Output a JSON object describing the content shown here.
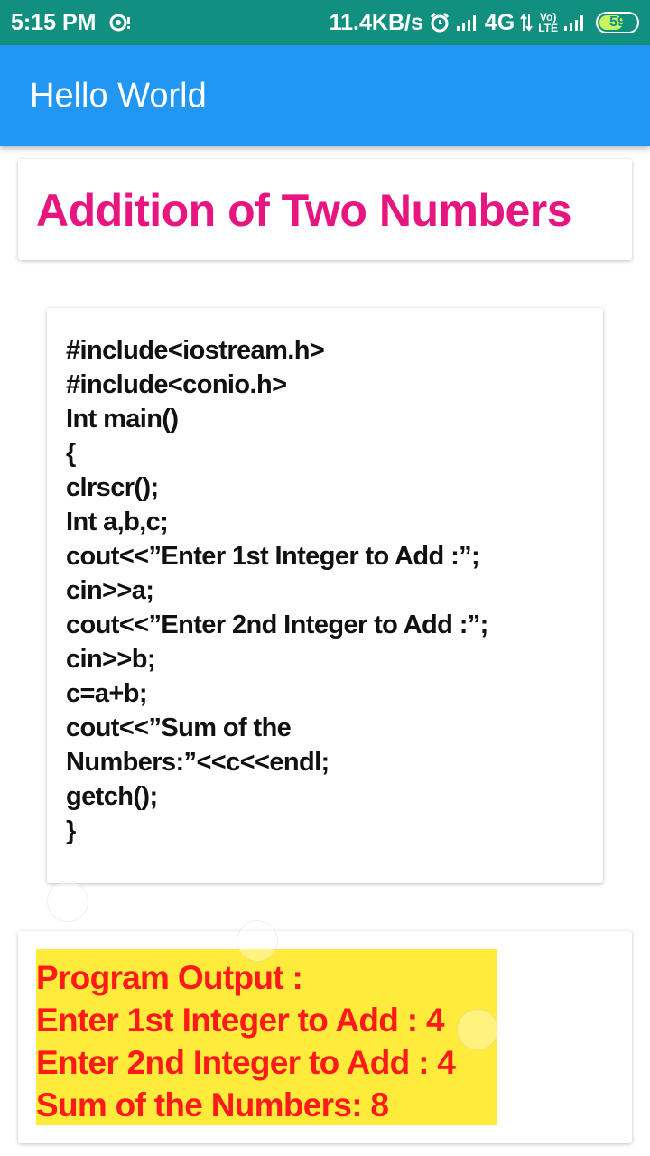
{
  "status_bar": {
    "time": "5:15 PM",
    "speed": "11.4KB/s",
    "network": "4G",
    "volte_top": "Vo)",
    "volte_bottom": "LTE",
    "battery": "59",
    "battery_level": 0.59
  },
  "app_bar": {
    "title": "Hello World"
  },
  "title_card": {
    "heading": "Addition of Two Numbers"
  },
  "code": {
    "lines": [
      "#include<iostream.h>",
      "#include<conio.h>",
      "Int main()",
      "{",
      "clrscr();",
      "Int a,b,c;",
      "cout<<”Enter 1st Integer to Add :”;",
      "cin>>a;",
      "cout<<”Enter 2nd Integer to Add :”;",
      "cin>>b;",
      "c=a+b;",
      "cout<<”Sum of the",
      "Numbers:”<<c<<endl;",
      "getch();",
      "}"
    ]
  },
  "output": {
    "lines": [
      "Program Output :",
      "Enter 1st Integer to Add : 4",
      "Enter 2nd Integer to Add : 4",
      "Sum of the Numbers: 8"
    ]
  },
  "colors": {
    "status_bar": "#12907f",
    "app_bar": "#2196f3",
    "heading": "#e6157f",
    "output_bg": "#ffeb3b",
    "output_text": "#ff1a1a"
  }
}
